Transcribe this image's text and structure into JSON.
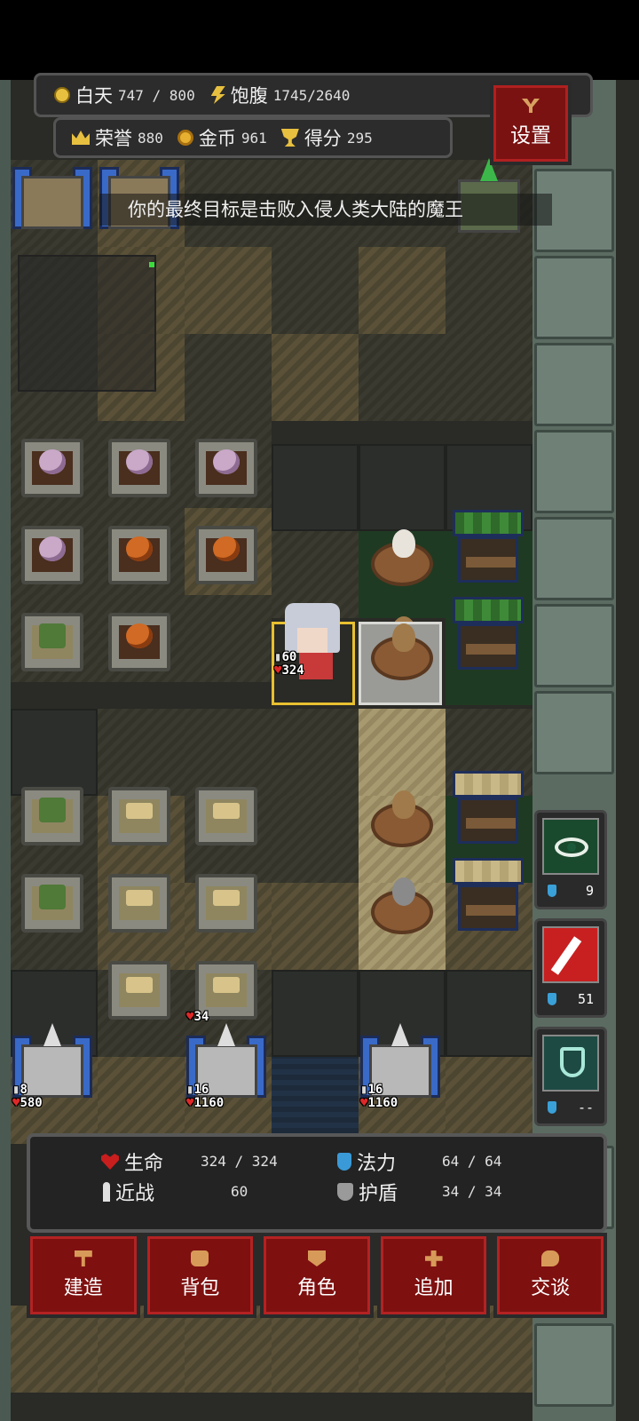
{
  "hud": {
    "day_label": "白天",
    "day_value": "747 / 800",
    "satiety_label": "饱腹",
    "satiety_value": "1745/2640",
    "honor_label": "荣誉",
    "honor_value": "880",
    "gold_label": "金币",
    "gold_value": "961",
    "score_label": "得分",
    "score_value": "295",
    "settings_label": "设置"
  },
  "hint": "你的最终目标是击败入侵人类大陆的魔王",
  "player": {
    "attack": "60",
    "hp": "324"
  },
  "units": {
    "wheat_hp": "34",
    "castle_left": {
      "attack": "8",
      "hp": "580"
    },
    "castle_mid": {
      "attack": "16",
      "hp": "1160"
    },
    "castle_right": {
      "attack": "16",
      "hp": "1160"
    }
  },
  "skills": [
    {
      "icon": "eye-icon",
      "cost": "9"
    },
    {
      "icon": "slash-icon",
      "cost": "51"
    },
    {
      "icon": "shield-icon",
      "cost": "--"
    }
  ],
  "stats": {
    "life_label": "生命",
    "life_value": "324 / 324",
    "mana_label": "法力",
    "mana_value": "64 / 64",
    "melee_label": "近战",
    "melee_value": "60",
    "shield_label": "护盾",
    "shield_value": "34 / 34"
  },
  "actions": {
    "build": "建造",
    "bag": "背包",
    "character": "角色",
    "add": "追加",
    "talk": "交谈"
  },
  "colors": {
    "accent_red": "#7e1010",
    "panel": "#232323",
    "gold": "#e8c040"
  }
}
